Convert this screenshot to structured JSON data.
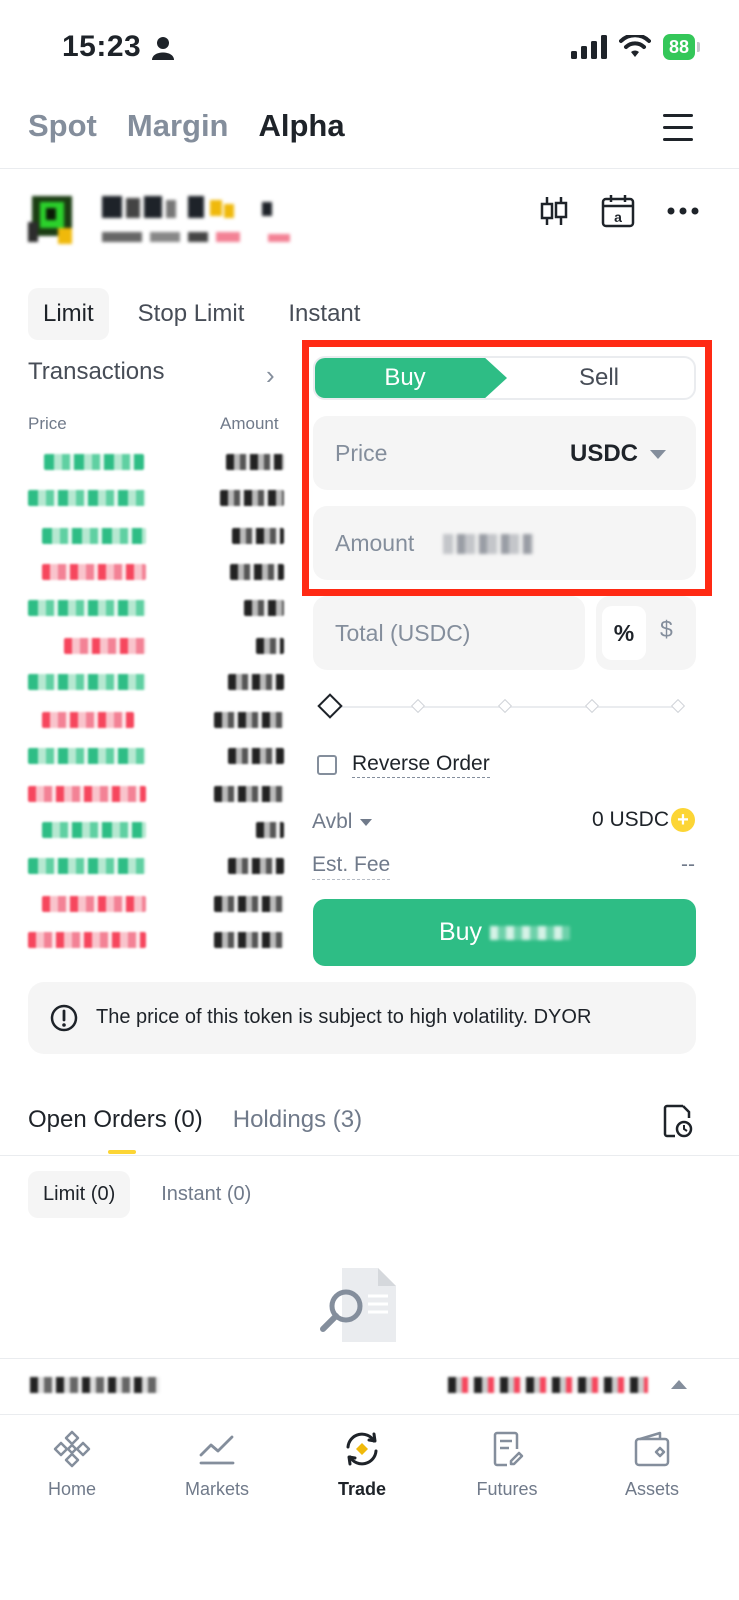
{
  "status_bar": {
    "time": "15:23",
    "battery": "88"
  },
  "top_tabs": [
    {
      "label": "Spot",
      "active": false
    },
    {
      "label": "Margin",
      "active": false
    },
    {
      "label": "Alpha",
      "active": true
    }
  ],
  "order_types": [
    "Limit",
    "Stop Limit",
    "Instant"
  ],
  "transactions": {
    "title": "Transactions",
    "price_header": "Price",
    "amount_header": "Amount"
  },
  "trade_form": {
    "buy_label": "Buy",
    "sell_label": "Sell",
    "price_label": "Price",
    "price_unit": "USDC",
    "amount_label": "Amount",
    "total_label": "Total (USDC)",
    "percent_label": "%",
    "dollar_label": "$",
    "reverse_order_label": "Reverse Order",
    "avbl_label": "Avbl",
    "avbl_value": "0 USDC",
    "fee_label": "Est. Fee",
    "fee_value": "--",
    "buy_button_label": "Buy"
  },
  "notice": "The price of this token is subject to high volatility. DYOR",
  "orders": {
    "open_orders_label": "Open Orders (0)",
    "holdings_label": "Holdings (3)",
    "sub_tabs": [
      "Limit (0)",
      "Instant (0)"
    ]
  },
  "bottom_nav": [
    "Home",
    "Markets",
    "Trade",
    "Futures",
    "Assets"
  ],
  "colors": {
    "buy": "#2ebd85",
    "sell": "#f6465d",
    "accent": "#fcd535",
    "highlight": "#ff2a14"
  }
}
